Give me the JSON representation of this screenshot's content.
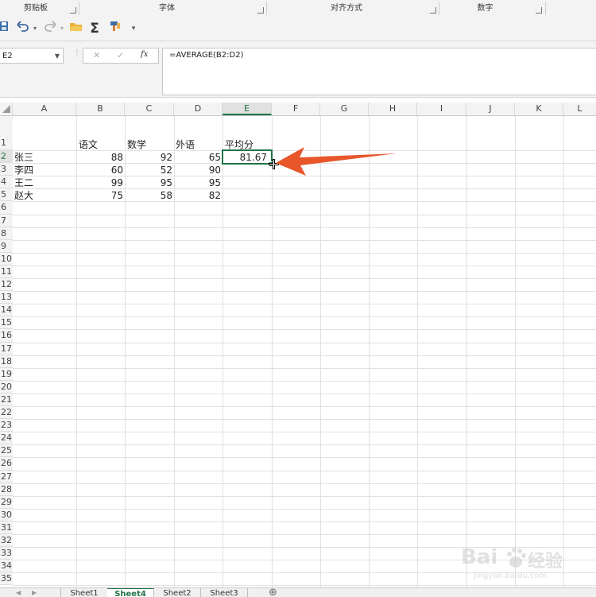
{
  "ribbon": {
    "groups": [
      {
        "label": "剪贴板"
      },
      {
        "label": "字体"
      },
      {
        "label": "对齐方式"
      },
      {
        "label": "数字"
      }
    ]
  },
  "qat": {
    "sum_symbol": "Σ",
    "more": "▾"
  },
  "formula_bar": {
    "name_box": "E2",
    "cancel": "✕",
    "enter": "✓",
    "fx": "fx",
    "formula": "=AVERAGE(B2:D2)"
  },
  "columns": [
    "A",
    "B",
    "C",
    "D",
    "E",
    "F",
    "G",
    "H",
    "I",
    "J",
    "K",
    "L"
  ],
  "selected_column": "E",
  "rows": [
    "1",
    "2",
    "3",
    "4",
    "5",
    "6",
    "7",
    "8",
    "9",
    "10",
    "11",
    "12",
    "13",
    "14",
    "15",
    "16",
    "17",
    "18",
    "19",
    "20",
    "21",
    "22",
    "23",
    "24",
    "25",
    "26",
    "27",
    "28",
    "29",
    "30",
    "31",
    "32",
    "33",
    "34",
    "35"
  ],
  "selected_row": "2",
  "headers": {
    "b1": "语文",
    "c1": "数学",
    "d1": "外语",
    "e1": "平均分"
  },
  "table": [
    {
      "name": "张三",
      "b": "88",
      "c": "92",
      "d": "65",
      "e": "81.67"
    },
    {
      "name": "李四",
      "b": "60",
      "c": "52",
      "d": "90",
      "e": ""
    },
    {
      "name": "王二",
      "b": "99",
      "c": "95",
      "d": "95",
      "e": ""
    },
    {
      "name": "赵大",
      "b": "75",
      "c": "58",
      "d": "82",
      "e": ""
    }
  ],
  "sheet_tabs": [
    {
      "label": "Sheet1"
    },
    {
      "label": "Sheet4"
    },
    {
      "label": "Sheet2"
    },
    {
      "label": "Sheet3"
    }
  ],
  "active_sheet": "Sheet4",
  "add_sheet": "⊕",
  "watermark": {
    "brand": "Bai",
    "brand2": "经验",
    "url": "jingyan.baidu.com"
  },
  "colors": {
    "accent": "#217346",
    "arrow": "#e8562c"
  }
}
